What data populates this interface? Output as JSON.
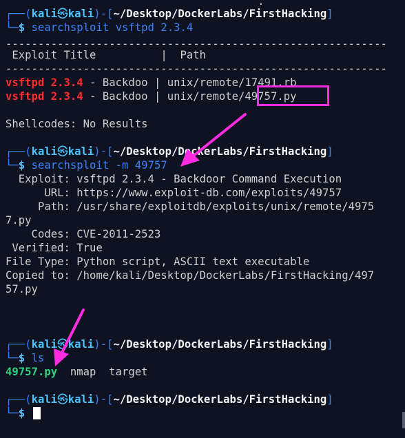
{
  "prompt": {
    "user": "kali",
    "host": "kali",
    "at_symbol": "㉿",
    "path": "~/Desktop/DockerLabs/FirstHacking",
    "prefix_top": "┌──(",
    "middle": ")-[",
    "close": "]",
    "prefix_bottom": "└─",
    "dollar": "$"
  },
  "block1": {
    "command": "searchsploit vsftpd 2.3.4",
    "divider": "-----------------------------------------------------------",
    "header_left": " Exploit Title",
    "header_sep": "|",
    "header_right": "  Path",
    "rows": [
      {
        "name": "vsftpd 2.3.4",
        "title": " - Backdoo",
        "sep": " | ",
        "path": "unix/remote/17491.rb"
      },
      {
        "name": "vsftpd 2.3.4",
        "title": " - Backdoo",
        "sep": " | ",
        "path": "unix/remote/49757.py"
      }
    ],
    "shellcodes": "Shellcodes: No Results"
  },
  "block2": {
    "command": "searchsploit -m 49757",
    "fields": [
      {
        "label": "  Exploit:",
        "value": " vsftpd 2.3.4 - Backdoor Command Execution"
      },
      {
        "label": "      URL:",
        "value": " https://www.exploit-db.com/exploits/49757"
      },
      {
        "label": "     Path:",
        "value": " /usr/share/exploitdb/exploits/unix/remote/4975"
      },
      {
        "label": "",
        "value": "7.py"
      },
      {
        "label": "    Codes:",
        "value": " CVE-2011-2523"
      },
      {
        "label": " Verified:",
        "value": " True"
      },
      {
        "label": "File Type:",
        "value": " Python script, ASCII text executable"
      },
      {
        "label": "Copied to:",
        "value": " /home/kali/Desktop/DockerLabs/FirstHacking/497"
      },
      {
        "label": "",
        "value": "57.py"
      }
    ]
  },
  "block3": {
    "command": "ls",
    "files": [
      {
        "name": "49757.py",
        "type": "executable"
      },
      {
        "name": "nmap",
        "type": "regular"
      },
      {
        "name": "target",
        "type": "regular"
      }
    ]
  },
  "colors": {
    "background": "#0e1221",
    "prompt_blue": "#3b82f6",
    "prompt_cyan": "#4bc6ff",
    "exec_green": "#2fd27c",
    "match_red": "#ff2d2d",
    "annotation_magenta": "#ff2be0"
  },
  "annotations": [
    {
      "type": "highlight-box",
      "target": "49757.py in search results"
    },
    {
      "type": "arrow",
      "target": "searchsploit -m 49757"
    },
    {
      "type": "arrow",
      "target": "49757.py in ls output"
    }
  ]
}
